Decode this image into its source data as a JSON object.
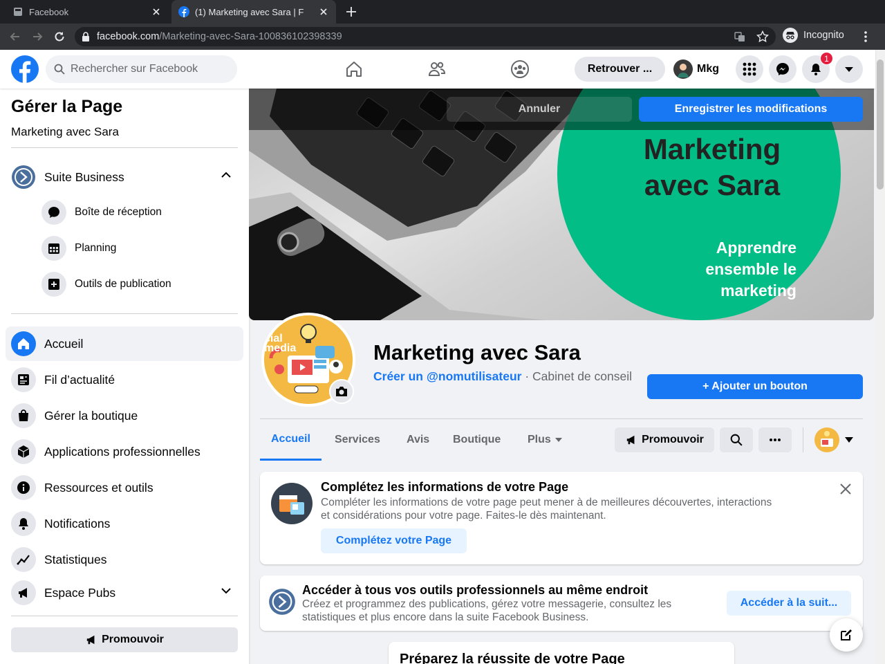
{
  "browser": {
    "tabs": [
      {
        "title": "Facebook"
      },
      {
        "title": "(1) Marketing avec Sara | F"
      }
    ],
    "url_host": "facebook.com",
    "url_path": "/Marketing-avec-Sara-100836102398339",
    "incognito_label": "Incognito"
  },
  "header": {
    "search_placeholder": "Rechercher sur Facebook",
    "find_friends": "Retrouver ...",
    "profile_name": "Mkg",
    "notification_count": "1"
  },
  "sidebar": {
    "title": "Gérer la Page",
    "subtitle": "Marketing avec Sara",
    "business_suite": "Suite Business",
    "sub_items": [
      "Boîte de réception",
      "Planning",
      "Outils de publication"
    ],
    "items": [
      "Accueil",
      "Fil d’actualité",
      "Gérer la boutique",
      "Applications professionnelles",
      "Ressources et outils",
      "Notifications",
      "Statistiques",
      "Espace Pubs"
    ],
    "promote": "Promouvoir"
  },
  "cover": {
    "cancel": "Annuler",
    "save": "Enregistrer les modifications",
    "brand_line1": "Marketing",
    "brand_line2": "avec Sara",
    "tag_line1": "Apprendre",
    "tag_line2": "ensemble le",
    "tag_line3": "marketing"
  },
  "page": {
    "name": "Marketing avec Sara",
    "username_link": "Créer un @nomutilisateur",
    "category": " · Cabinet de conseil",
    "add_button": "+ Ajouter un bouton",
    "tabs": [
      "Accueil",
      "Services",
      "Avis",
      "Boutique",
      "Plus"
    ],
    "promote": "Promouvoir"
  },
  "cards": {
    "complete": {
      "title": "Complétez les informations de votre Page",
      "text": "Compléter les informations de votre page peut mener à de meilleures découvertes, interactions et considérations pour votre page. Faites-le dès maintenant.",
      "button": "Complétez votre Page"
    },
    "tools": {
      "title": "Accéder à tous vos outils professionnels au même endroit",
      "text": "Créez et programmez des publications, gérez votre messagerie, consultez les statistiques et plus encore dans la suite Facebook Business.",
      "button": "Accéder à la suit..."
    },
    "prepare": {
      "title": "Préparez la réussite de votre Page"
    }
  },
  "colors": {
    "accent": "#1877f2",
    "cover_green": "#03bd86"
  }
}
